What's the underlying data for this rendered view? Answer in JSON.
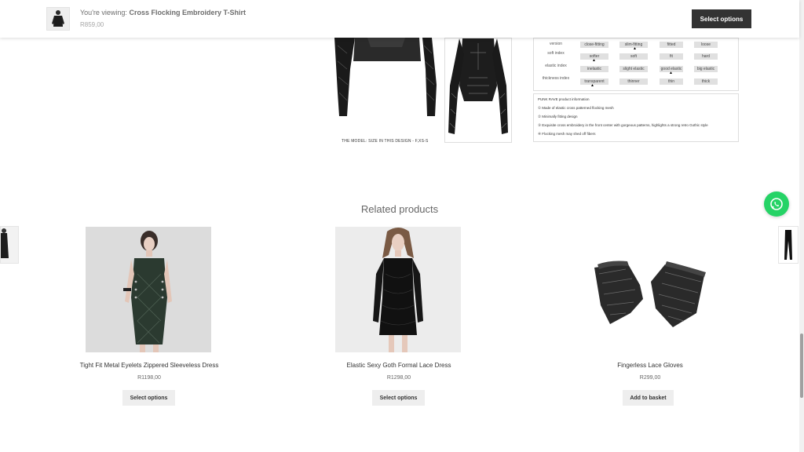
{
  "sticky": {
    "viewing_prefix": "You're viewing:",
    "product_title": "Cross Flocking Embroidery T-Shirt",
    "price": "R859,00",
    "button": "Select options"
  },
  "detail": {
    "model_caption": "THE MODEL:  SIZE IN THIS DESIGN - F,XS-S",
    "spec_rows": [
      {
        "label": "version",
        "cells": [
          "close-fitting",
          "slim-fitting",
          "fitted",
          "loose"
        ]
      },
      {
        "label": "soft index",
        "cells": [
          "softer",
          "soft",
          "fit",
          "hard"
        ]
      },
      {
        "label": "elastic index",
        "cells": [
          "inelastic",
          "slight elastic",
          "good elastic",
          "big elastic"
        ]
      },
      {
        "label": "thickness index",
        "cells": [
          "transparent",
          "thinner",
          "thin",
          "thick"
        ]
      }
    ],
    "info_title": "PUNK RAVE product information",
    "info_lines": [
      "① Made of elastic cross patterned flocking mesh",
      "② Minimally fitting design",
      "③ Exquisite cross embroidery in the front center with gorgeous patterns, highlights a strong retro Gothic style",
      "④ Flocking mesh may shed off fibers"
    ]
  },
  "related": {
    "title": "Related products",
    "products": [
      {
        "name": "Tight Fit Metal Eyelets Zippered Sleeveless Dress",
        "price": "R1198,00",
        "button": "Select options"
      },
      {
        "name": "Elastic Sexy Goth Formal Lace Dress",
        "price": "R1298,00",
        "button": "Select options"
      },
      {
        "name": "Fingerless Lace Gloves",
        "price": "R299,00",
        "button": "Add to basket"
      }
    ]
  },
  "colors": {
    "dark_button": "#333333",
    "light_button": "#eeeeee",
    "whatsapp": "#25d366"
  }
}
